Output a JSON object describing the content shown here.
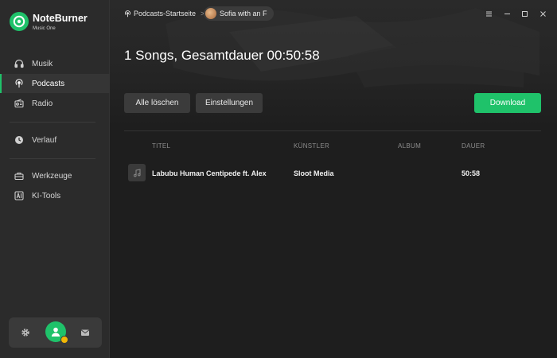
{
  "app": {
    "name": "NoteBurner",
    "subtitle": "Music One"
  },
  "sidebar": {
    "items": [
      {
        "label": "Musik",
        "icon": "headphones-icon",
        "active": false
      },
      {
        "label": "Podcasts",
        "icon": "podcast-icon",
        "active": true
      },
      {
        "label": "Radio",
        "icon": "radio-icon",
        "active": false
      },
      {
        "label": "Verlauf",
        "icon": "clock-icon",
        "active": false
      },
      {
        "label": "Werkzeuge",
        "icon": "toolbox-icon",
        "active": false
      },
      {
        "label": "KI-Tools",
        "icon": "ai-icon",
        "active": false
      }
    ],
    "bottom": {
      "settings_icon": "gear-icon",
      "account_icon": "user-icon",
      "mail_icon": "mail-icon"
    }
  },
  "breadcrumb": {
    "home_label": "Podcasts-Startseite",
    "separator": ">",
    "current_label": "Sofia with an F"
  },
  "window_controls": [
    "menu-icon",
    "minimize-icon",
    "maximize-icon",
    "close-icon"
  ],
  "main": {
    "title": "1 Songs, Gesamtdauer 00:50:58",
    "buttons": {
      "clear_all": "Alle löschen",
      "settings": "Einstellungen",
      "download": "Download"
    },
    "table": {
      "headers": {
        "title": "TITEL",
        "artist": "KÜNSTLER",
        "album": "ALBUM",
        "duration": "DAUER"
      },
      "rows": [
        {
          "title": "Labubu Human Centipede ft. Alex",
          "artist": "Sloot Media",
          "album": "",
          "duration": "50:58"
        }
      ]
    }
  },
  "colors": {
    "accent": "#1fc26a",
    "background": "#1e1e1e",
    "sidebar": "#2b2b2b",
    "badge": "#f2b705"
  }
}
